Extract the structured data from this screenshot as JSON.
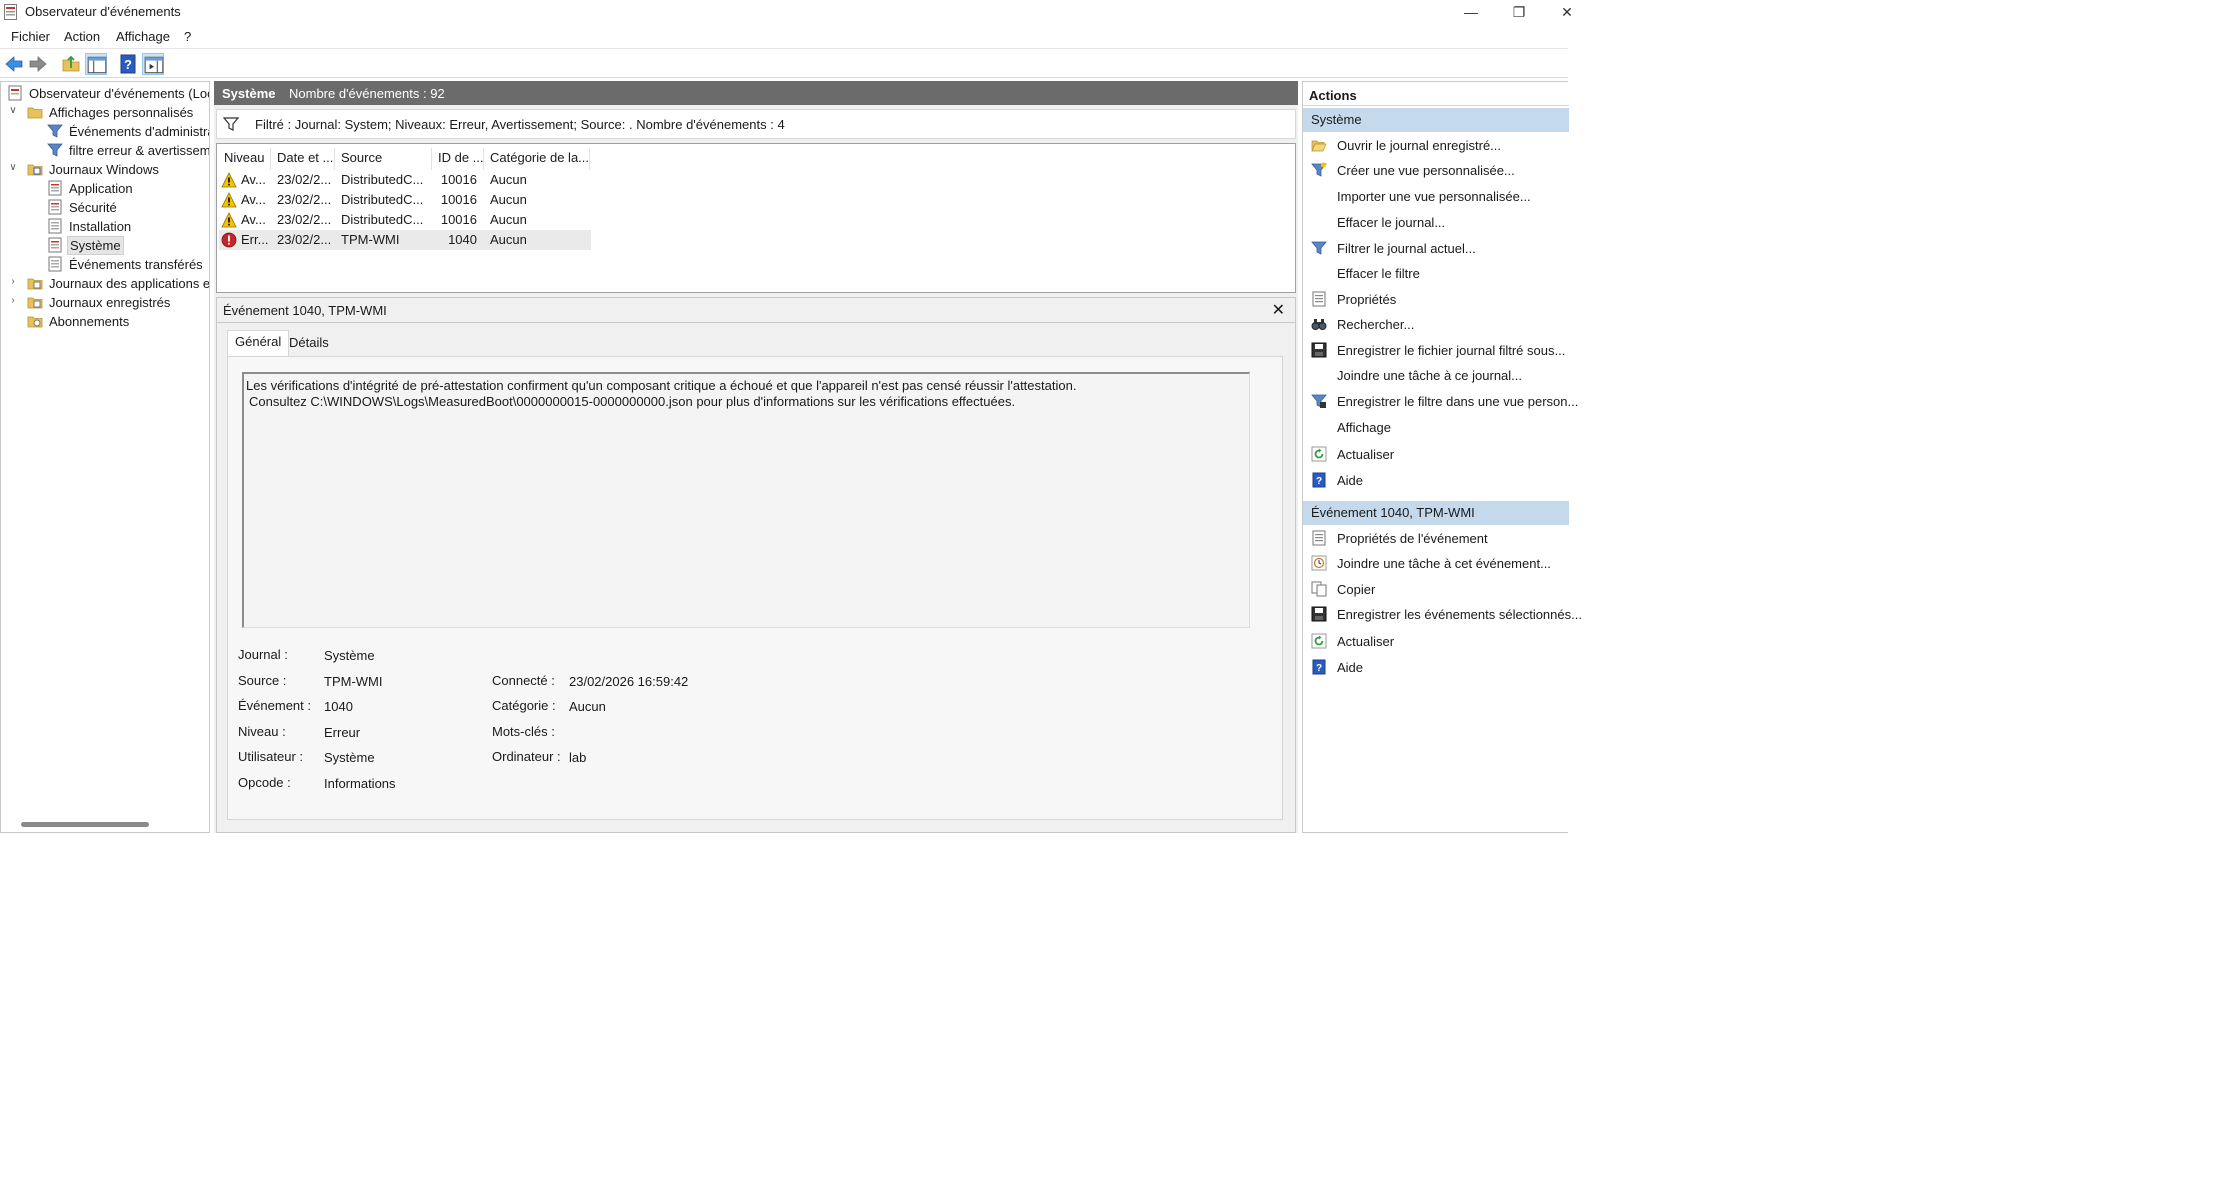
{
  "window": {
    "title": "Observateur d'événements",
    "minimize": "—",
    "restore": "❐",
    "close": "✕"
  },
  "menu": [
    "Fichier",
    "Action",
    "Affichage",
    "?"
  ],
  "tree": {
    "root": "Observateur d'événements (Loca",
    "custom_views": "Affichages personnalisés",
    "admin_events": "Événements d'administra",
    "filter_view": "filtre erreur & avertisseme",
    "windows_logs": "Journaux Windows",
    "application": "Application",
    "security": "Sécurité",
    "setup": "Installation",
    "system": "Système",
    "forwarded": "Événements transférés",
    "app_logs": "Journaux des applications et",
    "saved_logs": "Journaux enregistrés",
    "subscriptions": "Abonnements"
  },
  "header": {
    "title": "Système",
    "count": "Nombre d'événements : 92"
  },
  "filter": {
    "text": "Filtré : Journal: System; Niveaux: Erreur, Avertissement; Source: . Nombre d'événements : 4"
  },
  "columns": [
    "Niveau",
    "Date et ...",
    "Source",
    "ID de ...",
    "Catégorie de la..."
  ],
  "rows": [
    {
      "level": "Av...",
      "date": "23/02/2...",
      "source": "DistributedC...",
      "id": "10016",
      "category": "Aucun",
      "kind": "warning"
    },
    {
      "level": "Av...",
      "date": "23/02/2...",
      "source": "DistributedC...",
      "id": "10016",
      "category": "Aucun",
      "kind": "warning"
    },
    {
      "level": "Av...",
      "date": "23/02/2...",
      "source": "DistributedC...",
      "id": "10016",
      "category": "Aucun",
      "kind": "warning"
    },
    {
      "level": "Err...",
      "date": "23/02/2...",
      "source": "TPM-WMI",
      "id": "1040",
      "category": "Aucun",
      "kind": "error"
    }
  ],
  "detail": {
    "title": "Événement 1040, TPM-WMI",
    "close": "✕",
    "tabs": [
      "Général",
      "Détails"
    ],
    "message_line1": "Les vérifications d'intégrité de pré-attestation confirment qu'un composant critique a échoué et que l'appareil n'est pas censé réussir l'attestation.",
    "message_line2": "Consultez C:\\WINDOWS\\Logs\\MeasuredBoot\\0000000015-0000000000.json pour plus d'informations sur les vérifications effectuées.",
    "fields": {
      "journal_label": "Journal :",
      "journal": "Système",
      "source_label": "Source :",
      "source": "TPM-WMI",
      "event_label": "Événement :",
      "event": "1040",
      "level_label": "Niveau :",
      "level": "Erreur",
      "user_label": "Utilisateur :",
      "user": "Système",
      "opcode_label": "Opcode :",
      "opcode": "Informations",
      "logged_label": "Connecté :",
      "logged": "23/02/2026 16:59:42",
      "category_label": "Catégorie :",
      "category": "Aucun",
      "keywords_label": "Mots-clés :",
      "keywords": "",
      "computer_label": "Ordinateur :",
      "computer": "lab"
    }
  },
  "actions": {
    "title": "Actions",
    "section1": "Système",
    "items1": [
      "Ouvrir le journal enregistré...",
      "Créer une vue personnalisée...",
      "Importer une vue personnalisée...",
      "Effacer le journal...",
      "Filtrer le journal actuel...",
      "Effacer le filtre",
      "Propriétés",
      "Rechercher...",
      "Enregistrer le fichier journal filtré sous...",
      "Joindre une tâche à ce journal...",
      "Enregistrer le filtre dans une vue person...",
      "Affichage",
      "Actualiser",
      "Aide"
    ],
    "section2": "Événement 1040, TPM-WMI",
    "items2": [
      "Propriétés de l'événement",
      "Joindre une tâche à cet événement...",
      "Copier",
      "Enregistrer les événements sélectionnés...",
      "Actualiser",
      "Aide"
    ]
  }
}
